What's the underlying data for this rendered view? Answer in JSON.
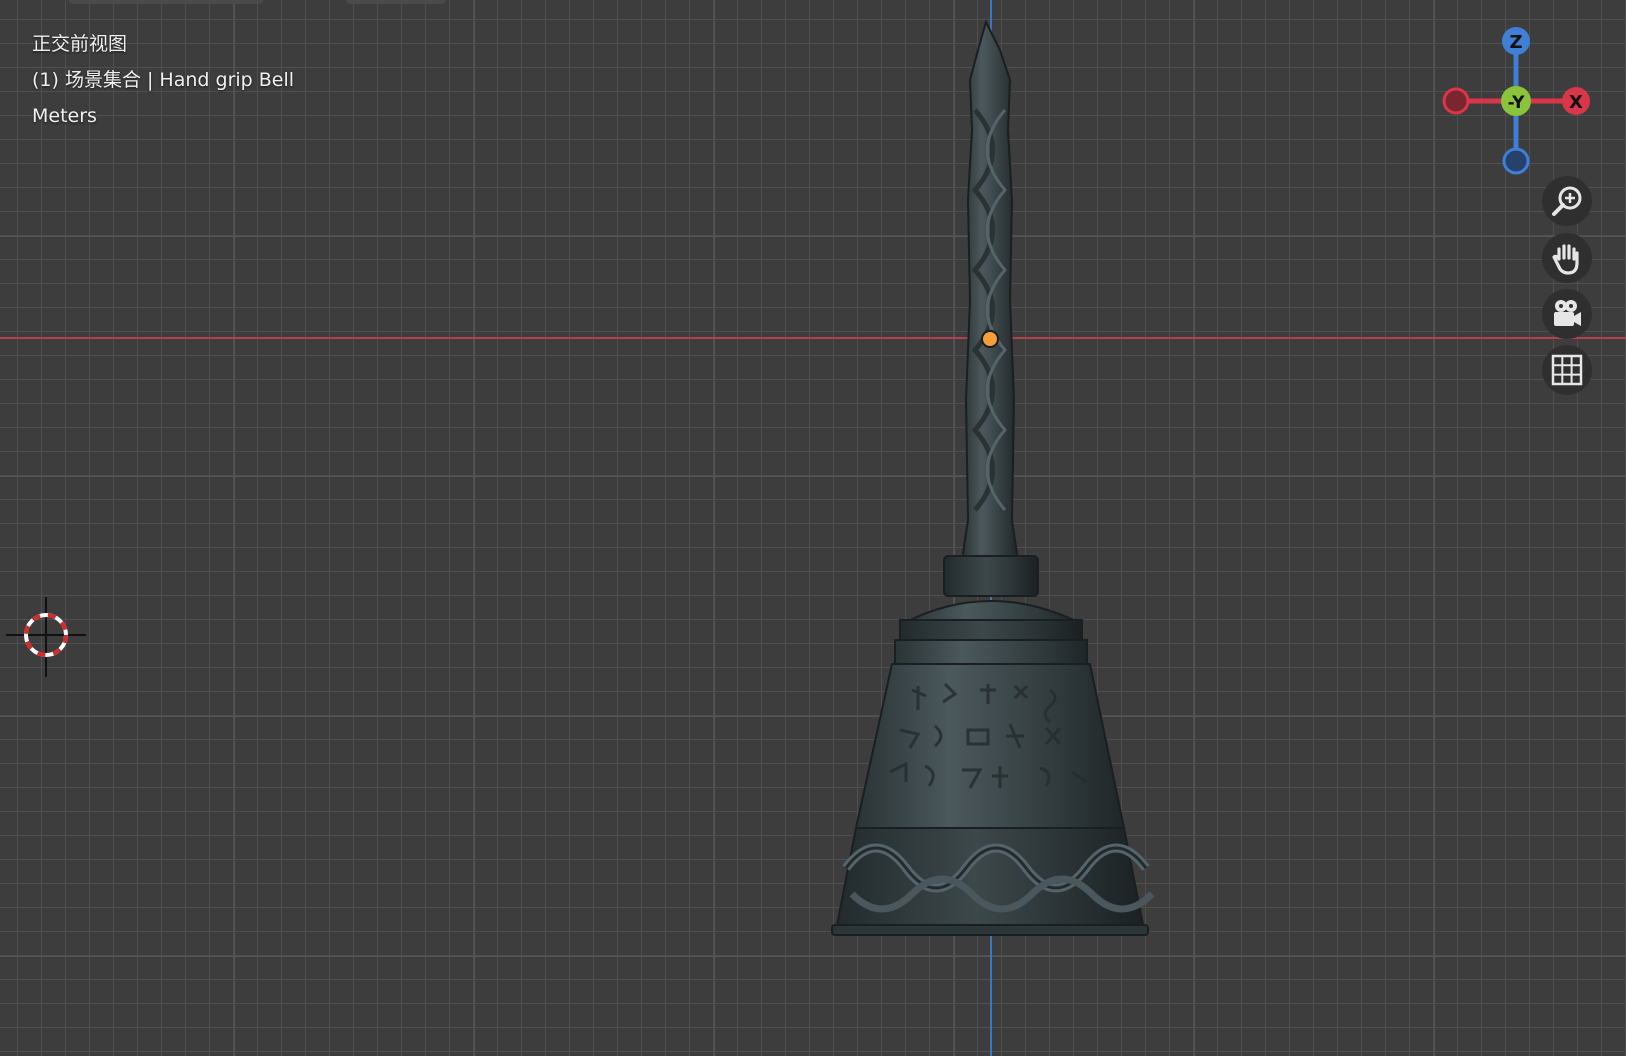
{
  "viewport": {
    "view_name": "正交前视图",
    "collection_line": "(1) 场景集合 | Hand grip Bell",
    "units": "Meters"
  },
  "gizmo": {
    "z_label": "Z",
    "y_label": "-Y",
    "x_label": "X",
    "colors": {
      "x": "#d9364a",
      "y": "#8ac43c",
      "z": "#3f7fd6"
    }
  },
  "nav_buttons": [
    {
      "icon": "zoom-icon"
    },
    {
      "icon": "hand-pan-icon"
    },
    {
      "icon": "camera-icon"
    },
    {
      "icon": "grid-perspective-icon"
    }
  ]
}
